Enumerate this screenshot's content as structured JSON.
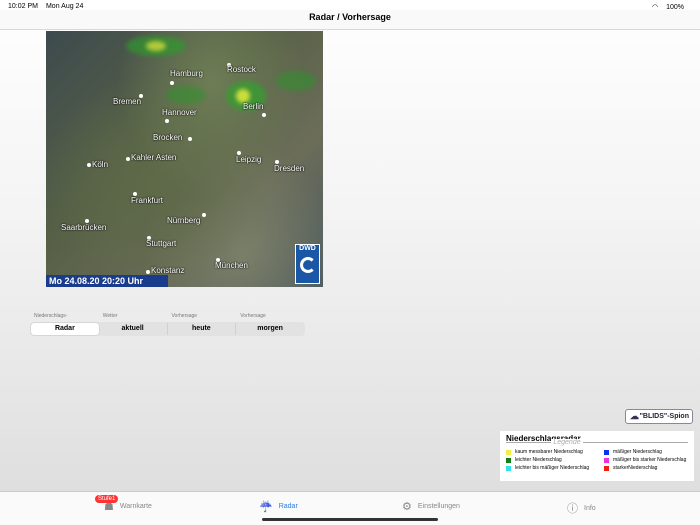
{
  "status": {
    "time": "10:02 PM",
    "date": "Mon Aug 24",
    "battery": "100%"
  },
  "nav": {
    "title": "Radar / Vorhersage"
  },
  "map": {
    "timestamp": "Mo 24.08.20  20:20 Uhr",
    "logo": "DWD",
    "cities": [
      "Rostock",
      "Hamburg",
      "Bremen",
      "Hannover",
      "Berlin",
      "Brocken",
      "Köln",
      "Kahler Asten",
      "Leipzig",
      "Dresden",
      "Frankfurt",
      "Nürnberg",
      "Saarbrücken",
      "Stuttgart",
      "München",
      "Konstanz"
    ]
  },
  "segments": [
    {
      "caption": "Niederschlags-",
      "label": "Radar",
      "selected": true
    },
    {
      "caption": "Wetter",
      "label": "aktuell"
    },
    {
      "caption": "Vorhersage",
      "label": "heute"
    },
    {
      "caption": "Vorhersage",
      "label": "morgen"
    }
  ],
  "blids": {
    "label": "\"BLIDS\"-Spion"
  },
  "legend": {
    "title": "Niederschlagsradar",
    "subtitle": "Legende",
    "items": [
      {
        "label": "kaum messbarer Niederschlag",
        "color": "#f0f040"
      },
      {
        "label": "mäßiger Niederschlag",
        "color": "#1030f0"
      },
      {
        "label": "leichter Niederschlag",
        "color": "#108010"
      },
      {
        "label": "mäßiger bis starker Niederschlag",
        "color": "#f030e0"
      },
      {
        "label": "leichter bis mäßiger Niederschlag",
        "color": "#30e0f0"
      },
      {
        "label": "starkerNiederschlag",
        "color": "#f02010"
      }
    ]
  },
  "tabs": {
    "warnkarte": "Warnkarte",
    "badge": "Stufe1",
    "radar": "Radar",
    "einstellungen": "Einstellungen",
    "info": "Info"
  }
}
